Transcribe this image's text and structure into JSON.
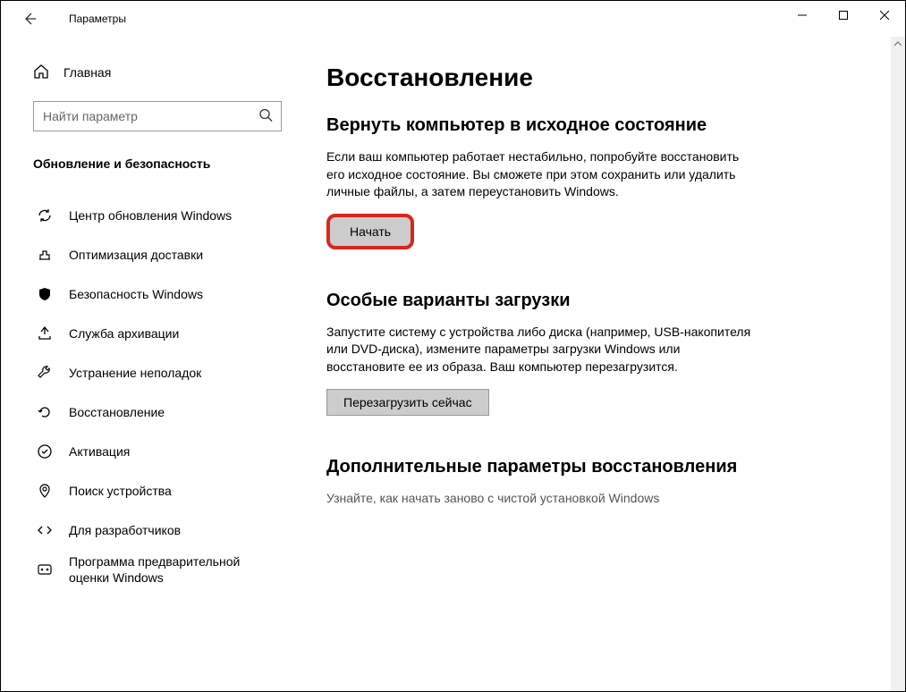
{
  "titlebar": {
    "title": "Параметры"
  },
  "sidebar": {
    "home_label": "Главная",
    "search_placeholder": "Найти параметр",
    "section_title": "Обновление и безопасность",
    "items": [
      {
        "label": "Центр обновления Windows"
      },
      {
        "label": "Оптимизация доставки"
      },
      {
        "label": "Безопасность Windows"
      },
      {
        "label": "Служба архивации"
      },
      {
        "label": "Устранение неполадок"
      },
      {
        "label": "Восстановление"
      },
      {
        "label": "Активация"
      },
      {
        "label": "Поиск устройства"
      },
      {
        "label": "Для разработчиков"
      },
      {
        "label": "Программа предварительной оценки Windows"
      }
    ]
  },
  "content": {
    "page_title": "Восстановление",
    "reset": {
      "heading": "Вернуть компьютер в исходное состояние",
      "body": "Если ваш компьютер работает нестабильно, попробуйте восстановить его исходное состояние. Вы сможете при этом сохранить или удалить личные файлы, а затем переустановить Windows.",
      "button": "Начать"
    },
    "advanced_startup": {
      "heading": "Особые варианты загрузки",
      "body": "Запустите систему с устройства либо диска (например, USB-накопителя или DVD-диска), измените параметры загрузки Windows или восстановите ее из образа. Ваш компьютер перезагрузится.",
      "button": "Перезагрузить сейчас"
    },
    "more": {
      "heading": "Дополнительные параметры восстановления",
      "body": "Узнайте, как начать заново с чистой установкой Windows"
    }
  }
}
